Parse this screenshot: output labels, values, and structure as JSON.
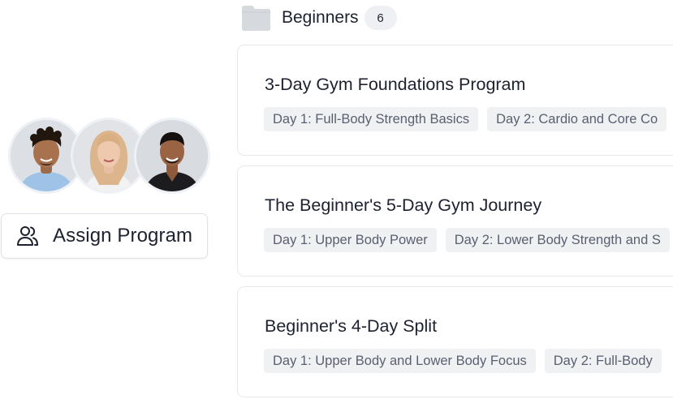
{
  "folder": {
    "icon": "folder-icon",
    "title": "Beginners",
    "count": "6"
  },
  "assign": {
    "icon": "users-icon",
    "label": "Assign Program"
  },
  "colors": {
    "card_border": "#e6e8ec",
    "tag_bg": "#f0f1f3",
    "tag_text": "#5a6070",
    "badge_bg": "#eef0f3",
    "folder_icon": "#d6d9de"
  },
  "programs": [
    {
      "title": "3-Day Gym Foundations Program",
      "days": [
        "Day 1: Full-Body Strength Basics",
        "Day 2: Cardio and Core Co"
      ]
    },
    {
      "title": "The Beginner's 5-Day Gym Journey",
      "days": [
        "Day 1: Upper Body Power",
        "Day 2: Lower Body Strength and S"
      ]
    },
    {
      "title": "Beginner's 4-Day Split",
      "days": [
        "Day 1: Upper Body and Lower Body Focus",
        "Day 2: Full-Body"
      ]
    }
  ]
}
